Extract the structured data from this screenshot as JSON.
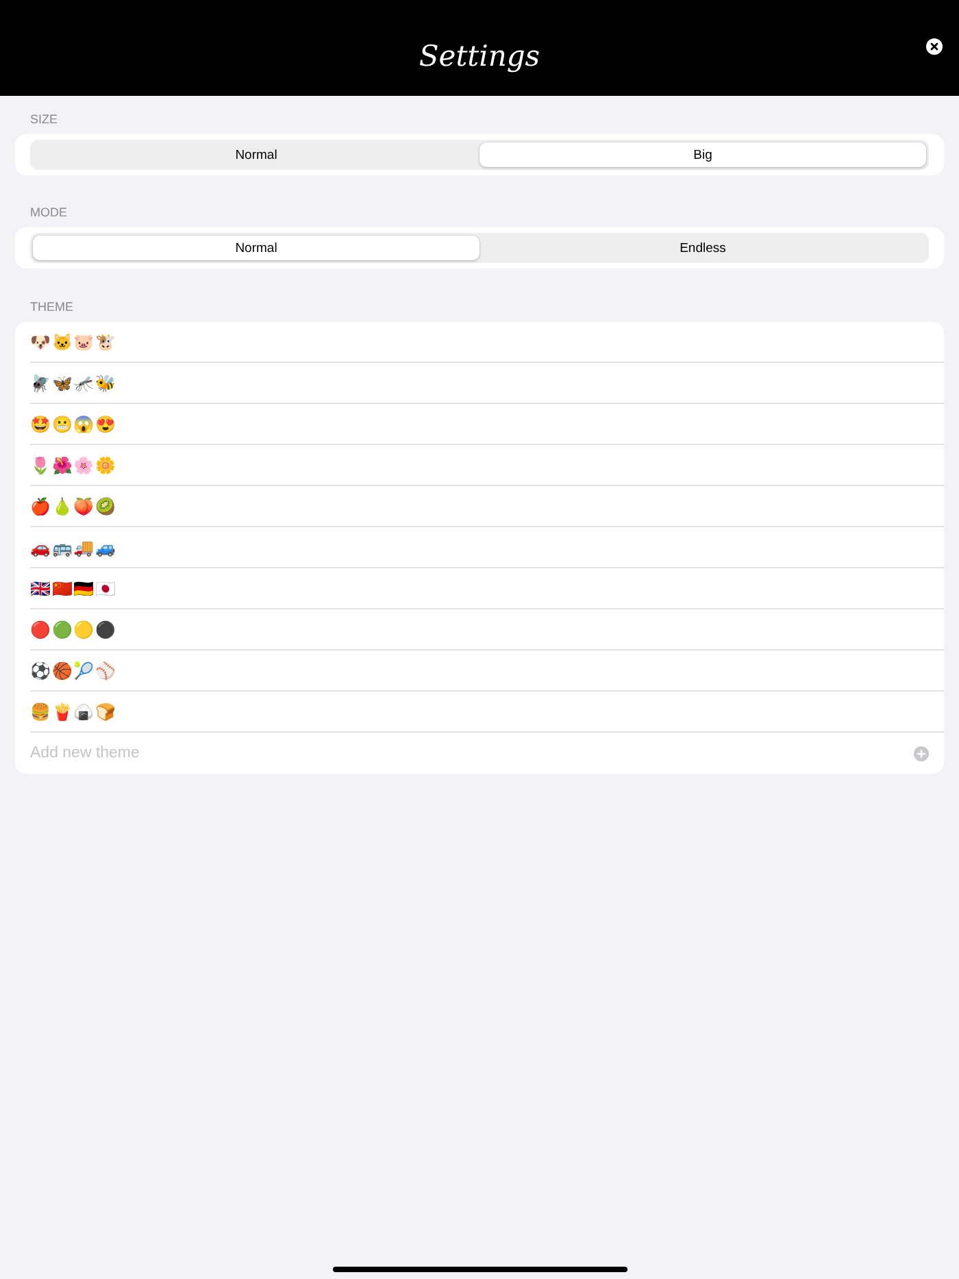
{
  "header": {
    "title": "Settings"
  },
  "sections": [
    {
      "label": "SIZE",
      "segments": [
        {
          "label": "Normal",
          "selected": false
        },
        {
          "label": "Big",
          "selected": true
        }
      ]
    },
    {
      "label": "MODE",
      "segments": [
        {
          "label": "Normal",
          "selected": true
        },
        {
          "label": "Endless",
          "selected": false
        }
      ]
    }
  ],
  "theme": {
    "label": "THEME",
    "themes": [
      "🐶🐱🐷🐮",
      "🪰🦋🦟🐝",
      "🤩😬😱😍",
      "🌷🌺🌸🌼",
      "🍎🍐🍑🥝",
      "🚗🚌🚚🚙",
      "🇬🇧🇨🇳🇩🇪🇯🇵",
      "🔴🟢🟡⚫",
      "⚽🏀🎾⚾",
      "🍔🍟🍙🍞"
    ],
    "add_field": {
      "placeholder": "Add new theme"
    }
  }
}
